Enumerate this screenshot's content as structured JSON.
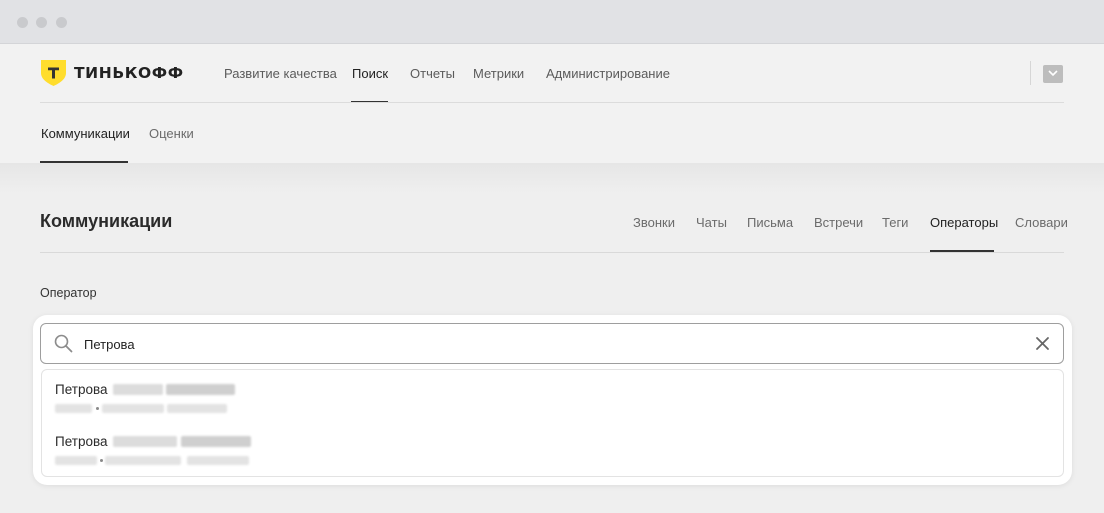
{
  "brand": {
    "name": "ТИНЬКОФФ",
    "color": "#ffdd2d"
  },
  "top_nav": [
    {
      "label": "Развитие качества",
      "active": false
    },
    {
      "label": "Поиск",
      "active": true
    },
    {
      "label": "Отчеты",
      "active": false
    },
    {
      "label": "Метрики",
      "active": false
    },
    {
      "label": "Администрирование",
      "active": false
    }
  ],
  "sub_nav": [
    {
      "label": "Коммуникации",
      "active": true
    },
    {
      "label": "Оценки",
      "active": false
    }
  ],
  "page": {
    "title": "Коммуникации",
    "tabs": [
      {
        "label": "Звонки",
        "active": false
      },
      {
        "label": "Чаты",
        "active": false
      },
      {
        "label": "Письма",
        "active": false
      },
      {
        "label": "Встречи",
        "active": false
      },
      {
        "label": "Теги",
        "active": false
      },
      {
        "label": "Операторы",
        "active": true
      },
      {
        "label": "Словари",
        "active": false
      }
    ]
  },
  "operator_field": {
    "label": "Оператор",
    "search_value": "Петрова",
    "results": [
      {
        "name": "Петрова"
      },
      {
        "name": "Петрова"
      }
    ]
  },
  "icons": {
    "search": "search-icon",
    "clear": "close-icon",
    "account": "chevron-down-icon"
  }
}
